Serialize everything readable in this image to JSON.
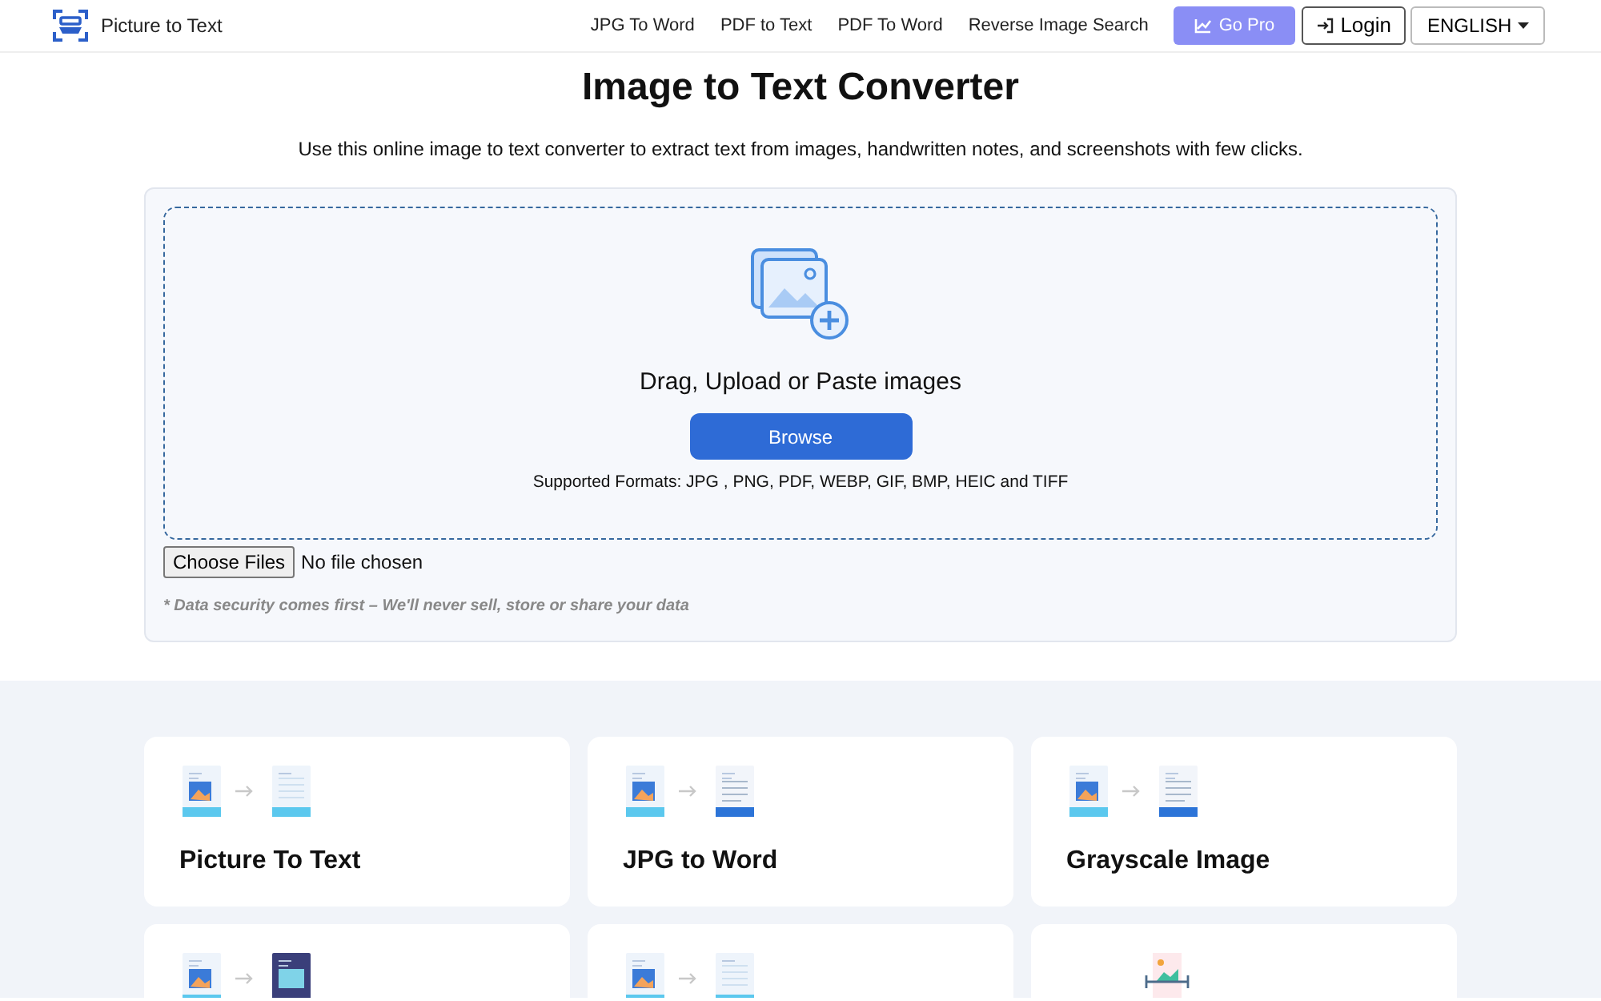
{
  "brand": {
    "name": "Picture to Text"
  },
  "nav": [
    {
      "label": "JPG To Word"
    },
    {
      "label": "PDF to Text"
    },
    {
      "label": "PDF To Word"
    },
    {
      "label": "Reverse Image Search"
    }
  ],
  "buttons": {
    "pro": "Go Pro",
    "login": "Login",
    "language": "ENGLISH"
  },
  "heading": "Image to Text Converter",
  "subtitle": "Use this online image to text converter to extract text from images, handwritten notes, and screenshots with few clicks.",
  "upload": {
    "prompt": "Drag, Upload or Paste images",
    "browse": "Browse",
    "formats": "Supported Formats: JPG , PNG, PDF, WEBP, GIF, BMP, HEIC and TIFF",
    "file_button": "Choose Files",
    "file_status": "No file chosen",
    "note": "* Data security comes first – We'll never sell, store or share your data"
  },
  "tools": [
    {
      "kind": "totext",
      "title": "Picture To Text"
    },
    {
      "kind": "todoc",
      "title": "JPG to Word"
    },
    {
      "kind": "todoc",
      "title": "Grayscale Image"
    },
    {
      "kind": "todark"
    },
    {
      "kind": "totext"
    },
    {
      "kind": "single"
    }
  ]
}
